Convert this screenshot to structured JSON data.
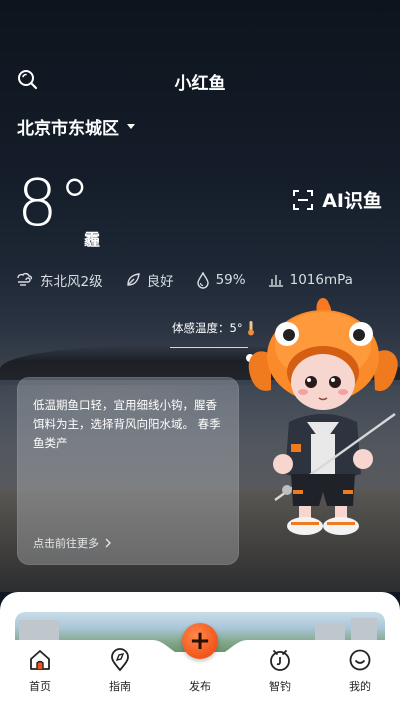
{
  "app_title": "小红鱼",
  "location": "北京市东城区",
  "weather": {
    "temperature": "8°",
    "condition": "霾",
    "wind": "东北风2级",
    "air_quality": "良好",
    "humidity": "59%",
    "pressure": "1016mPa",
    "feels_like": "体感温度：5°"
  },
  "ai_button_label": "AI识鱼",
  "tip_card": {
    "text": "低温期鱼口轻，宜用细线小钩，腥香饵料为主，选择背风向阳水域。 春季鱼类产",
    "more_label": "点击前往更多"
  },
  "tabs": [
    {
      "label": "首页",
      "icon": "home-icon"
    },
    {
      "label": "指南",
      "icon": "compass-pin-icon"
    },
    {
      "label": "发布",
      "icon": "plus-icon"
    },
    {
      "label": "智钓",
      "icon": "smart-fishing-icon"
    },
    {
      "label": "我的",
      "icon": "profile-icon"
    }
  ],
  "colors": {
    "accent": "#f2541b",
    "tab_text": "#222222"
  }
}
